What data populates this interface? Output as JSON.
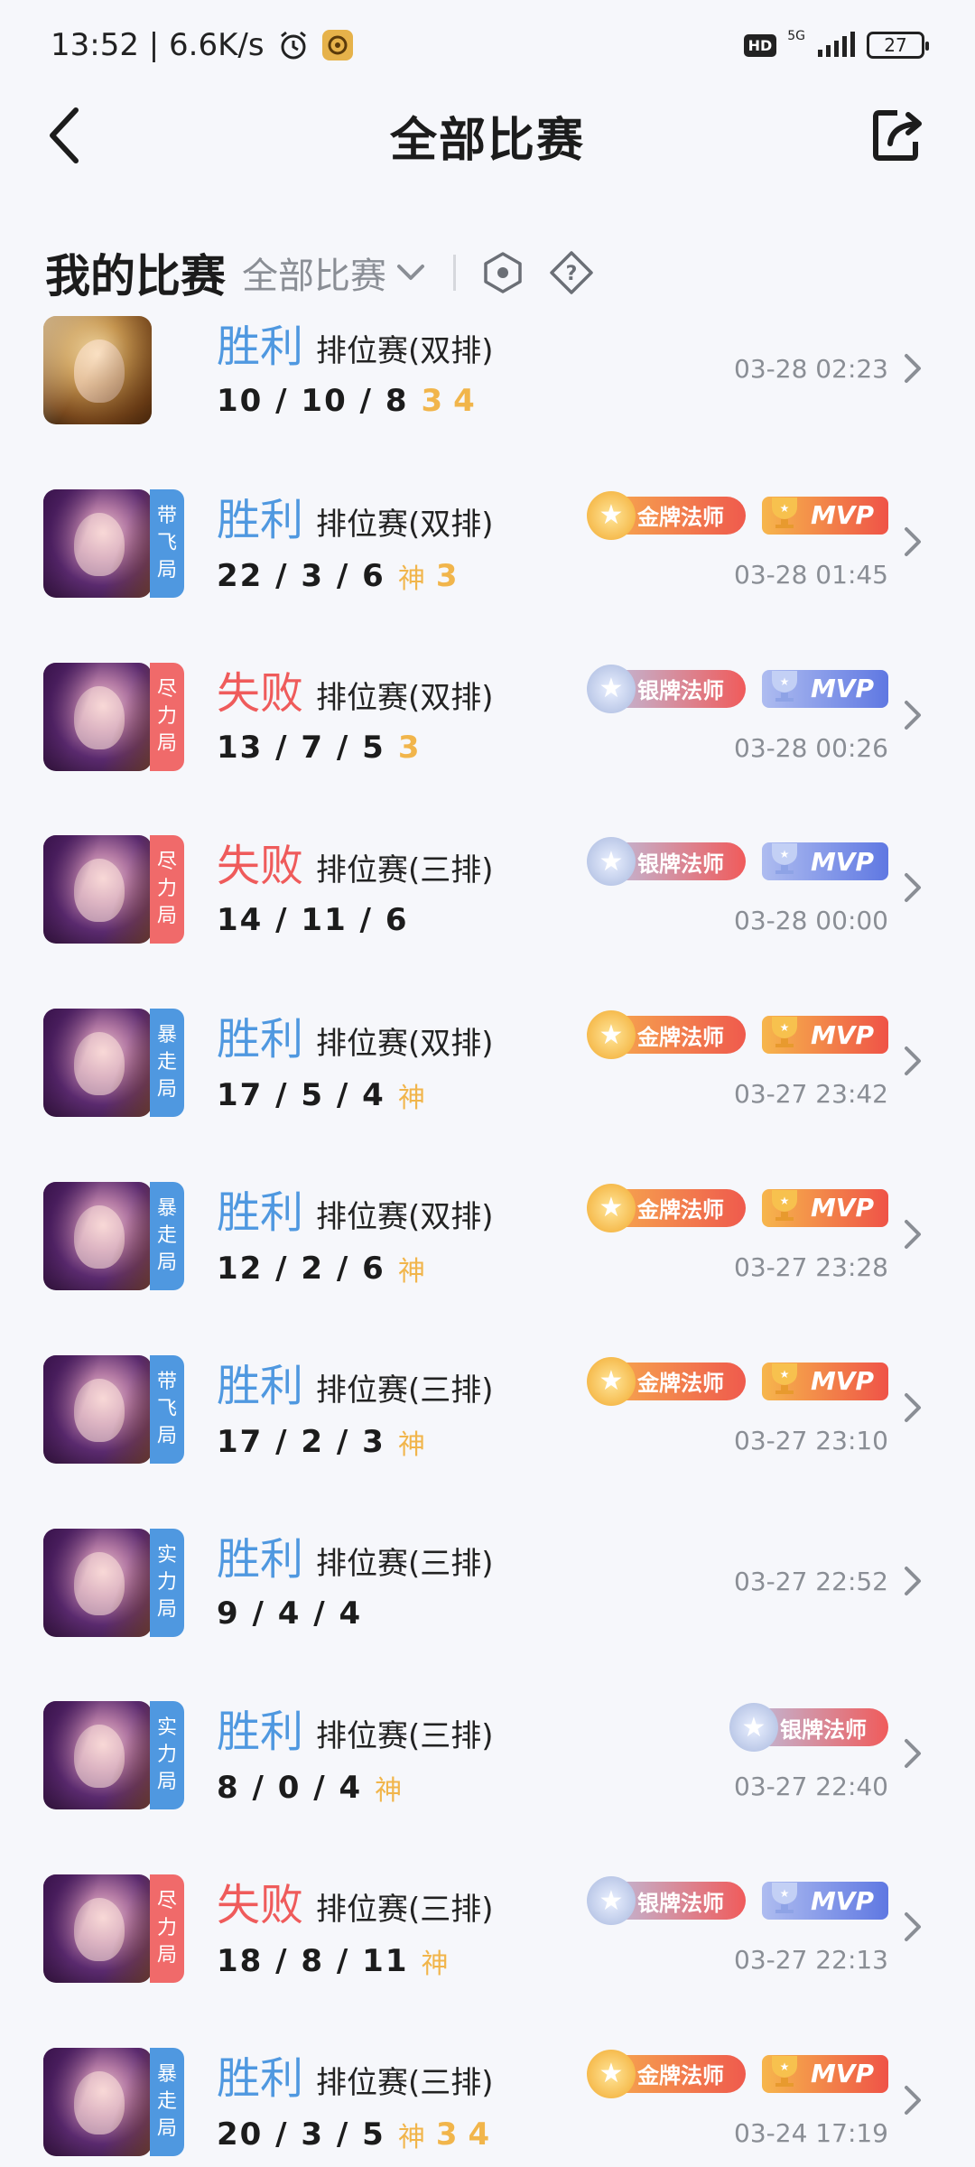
{
  "status_bar": {
    "time_speed": "13:52 | 6.6K/s",
    "hd": "HD",
    "network": "5G",
    "battery": "27"
  },
  "header": {
    "title": "全部比赛"
  },
  "filter": {
    "my_matches": "我的比赛",
    "selected": "全部比赛"
  },
  "matches": [
    {
      "result": "胜利",
      "outcome": "win",
      "mode": "排位赛(双排)",
      "kda": "10 / 10 / 8",
      "marks": [
        "3",
        "4"
      ],
      "tag": [],
      "tag_color": "",
      "hero": "gold",
      "title_badge": "",
      "mvp": "",
      "time": "03-28 02:23"
    },
    {
      "result": "胜利",
      "outcome": "win",
      "mode": "排位赛(双排)",
      "kda": "22 / 3 / 6",
      "marks": [
        "神",
        "3"
      ],
      "tag": [
        "带",
        "飞",
        "局"
      ],
      "tag_color": "blue",
      "hero": "purple",
      "title_badge": "金牌法师",
      "title_tier": "gold",
      "mvp": "MVP",
      "mvp_tier": "gold",
      "time": "03-28 01:45"
    },
    {
      "result": "失败",
      "outcome": "lose",
      "mode": "排位赛(双排)",
      "kda": "13 / 7 / 5",
      "marks": [
        "3"
      ],
      "tag": [
        "尽",
        "力",
        "局"
      ],
      "tag_color": "red",
      "hero": "purple",
      "title_badge": "银牌法师",
      "title_tier": "silver",
      "mvp": "MVP",
      "mvp_tier": "silver",
      "time": "03-28 00:26"
    },
    {
      "result": "失败",
      "outcome": "lose",
      "mode": "排位赛(三排)",
      "kda": "14 / 11 / 6",
      "marks": [],
      "tag": [
        "尽",
        "力",
        "局"
      ],
      "tag_color": "red",
      "hero": "purple",
      "title_badge": "银牌法师",
      "title_tier": "silver",
      "mvp": "MVP",
      "mvp_tier": "silver",
      "time": "03-28 00:00"
    },
    {
      "result": "胜利",
      "outcome": "win",
      "mode": "排位赛(双排)",
      "kda": "17 / 5 / 4",
      "marks": [
        "神"
      ],
      "tag": [
        "暴",
        "走",
        "局"
      ],
      "tag_color": "blue",
      "hero": "purple",
      "title_badge": "金牌法师",
      "title_tier": "gold",
      "mvp": "MVP",
      "mvp_tier": "gold",
      "time": "03-27 23:42"
    },
    {
      "result": "胜利",
      "outcome": "win",
      "mode": "排位赛(双排)",
      "kda": "12 / 2 / 6",
      "marks": [
        "神"
      ],
      "tag": [
        "暴",
        "走",
        "局"
      ],
      "tag_color": "blue",
      "hero": "purple",
      "title_badge": "金牌法师",
      "title_tier": "gold",
      "mvp": "MVP",
      "mvp_tier": "gold",
      "time": "03-27 23:28"
    },
    {
      "result": "胜利",
      "outcome": "win",
      "mode": "排位赛(三排)",
      "kda": "17 / 2 / 3",
      "marks": [
        "神"
      ],
      "tag": [
        "带",
        "飞",
        "局"
      ],
      "tag_color": "blue",
      "hero": "purple",
      "title_badge": "金牌法师",
      "title_tier": "gold",
      "mvp": "MVP",
      "mvp_tier": "gold",
      "time": "03-27 23:10"
    },
    {
      "result": "胜利",
      "outcome": "win",
      "mode": "排位赛(三排)",
      "kda": "9 / 4 / 4",
      "marks": [],
      "tag": [
        "实",
        "力",
        "局"
      ],
      "tag_color": "blue",
      "hero": "purple",
      "title_badge": "",
      "mvp": "",
      "time": "03-27 22:52"
    },
    {
      "result": "胜利",
      "outcome": "win",
      "mode": "排位赛(三排)",
      "kda": "8 / 0 / 4",
      "marks": [
        "神"
      ],
      "tag": [
        "实",
        "力",
        "局"
      ],
      "tag_color": "blue",
      "hero": "purple",
      "title_badge": "银牌法师",
      "title_tier": "silver",
      "mvp": "",
      "time": "03-27 22:40"
    },
    {
      "result": "失败",
      "outcome": "lose",
      "mode": "排位赛(三排)",
      "kda": "18 / 8 / 11",
      "marks": [
        "神"
      ],
      "tag": [
        "尽",
        "力",
        "局"
      ],
      "tag_color": "red",
      "hero": "purple",
      "title_badge": "银牌法师",
      "title_tier": "silver",
      "mvp": "MVP",
      "mvp_tier": "silver",
      "time": "03-27 22:13"
    },
    {
      "result": "胜利",
      "outcome": "win",
      "mode": "排位赛(三排)",
      "kda": "20 / 3 / 5",
      "marks": [
        "神",
        "3",
        "4"
      ],
      "tag": [
        "暴",
        "走",
        "局"
      ],
      "tag_color": "blue",
      "hero": "purple",
      "title_badge": "金牌法师",
      "title_tier": "gold",
      "mvp": "MVP",
      "mvp_tier": "gold",
      "time": "03-24 17:19"
    }
  ]
}
